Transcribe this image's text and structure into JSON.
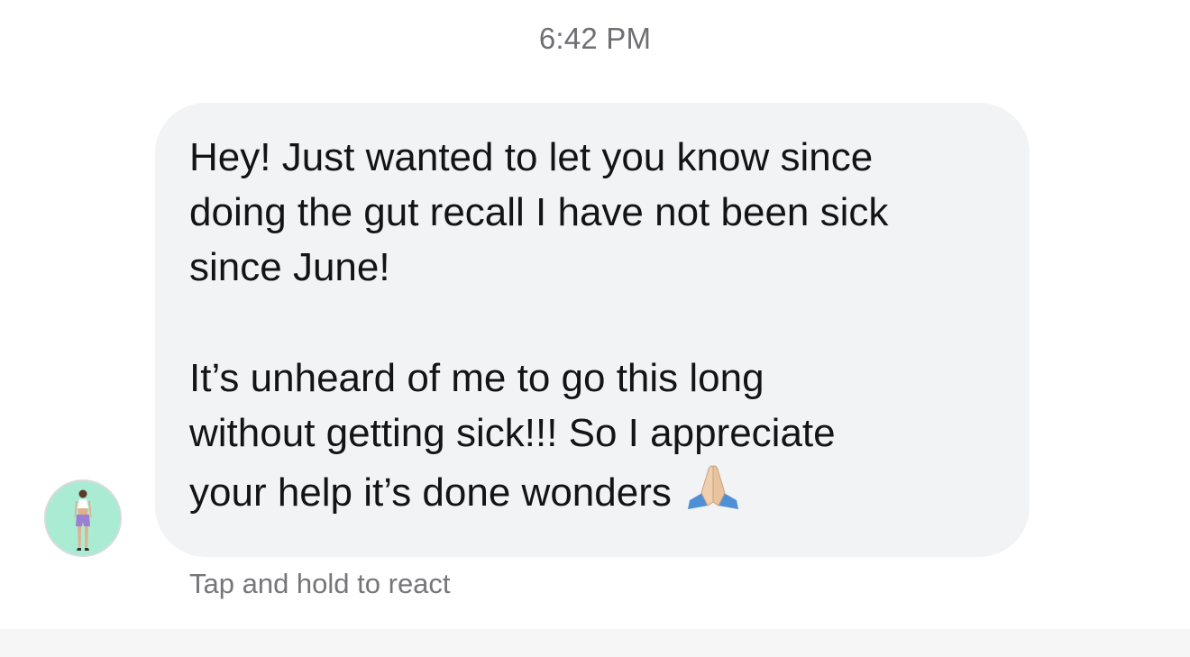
{
  "thread": {
    "timestamp": "6:42 PM"
  },
  "message": {
    "paragraph_1": "Hey! Just wanted to let you know since\ndoing the gut recall I have not been sick\nsince June!",
    "paragraph_2": "It’s unheard of me to go this long\nwithout getting sick!!! So I appreciate\nyour help it’s done wonders",
    "emoji": "folded-hands-emoji"
  },
  "reaction_hint": "Tap and hold to react",
  "colors": {
    "bubble": "#f2f3f5",
    "avatar_bg": "#a9ecd3",
    "text": "#141414",
    "secondary_text": "#6f6f73"
  },
  "icons": {
    "avatar": "sender-avatar",
    "emoji": "folded-hands-icon"
  }
}
